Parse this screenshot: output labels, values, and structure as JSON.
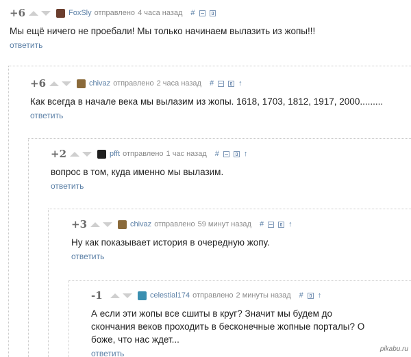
{
  "comments": [
    {
      "rating": "+6",
      "username": "FoxSly",
      "posted_label": "отправлено",
      "time": "4 часа назад",
      "hash": "#",
      "text": "Мы ещё ничего не проебали! Мы только начинаем вылазить из жопы!!!",
      "reply": "ответить",
      "avatar_color": "#6b3e2e"
    },
    {
      "rating": "+6",
      "username": "chivaz",
      "posted_label": "отправлено",
      "time": "2 часа назад",
      "hash": "#",
      "text": "Как всегда в начале века мы вылазим из жопы. 1618, 1703, 1812, 1917, 2000.........",
      "reply": "ответить",
      "avatar_color": "#8a6a3a"
    },
    {
      "rating": "+2",
      "username": "pfft",
      "posted_label": "отправлено",
      "time": "1 час назад",
      "hash": "#",
      "text": "вопрос в том, куда именно мы вылазим.",
      "reply": "ответить",
      "avatar_color": "#1f1f1f"
    },
    {
      "rating": "+3",
      "username": "chivaz",
      "posted_label": "отправлено",
      "time": "59 минут назад",
      "hash": "#",
      "text": "Ну как показывает история в очередную жопу.",
      "reply": "ответить",
      "avatar_color": "#8a6a3a"
    },
    {
      "rating": "-1",
      "username": "celestial174",
      "posted_label": "отправлено",
      "time": "2 минуты назад",
      "hash": "#",
      "text": "А если эти жопы все сшиты в круг? Значит мы будем до скончания веков проходить в бесконечные жопные порталы? О боже, что нас ждет...",
      "reply": "ответить",
      "avatar_color": "#3a8fb0"
    }
  ],
  "watermark": "pikabu.ru",
  "icons": [
    "vote-up-icon",
    "vote-down-icon",
    "minus-box-icon",
    "save-icon",
    "arrow-up-icon"
  ]
}
